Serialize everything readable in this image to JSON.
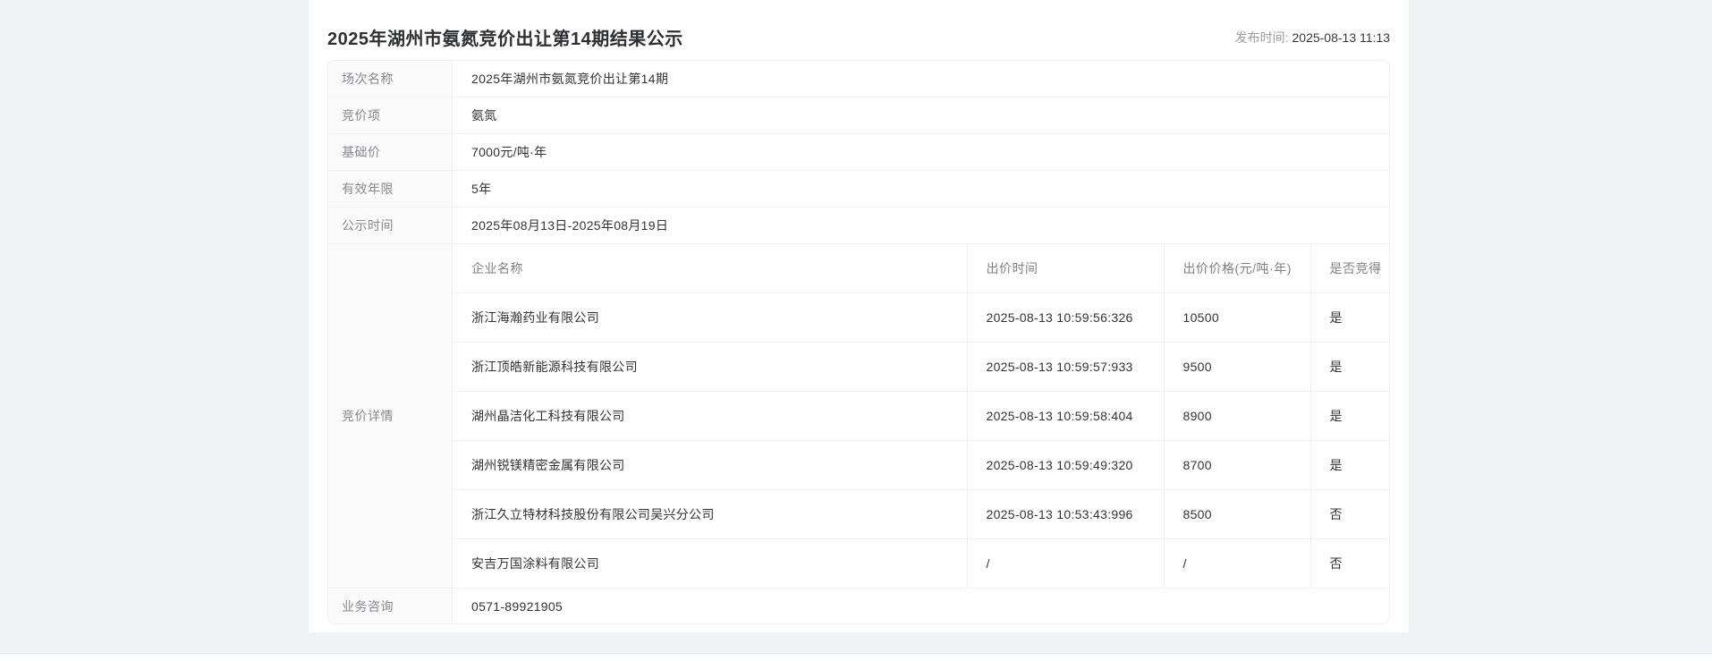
{
  "page": {
    "title": "2025年湖州市氨氮竞价出让第14期结果公示",
    "publish_time_label": "发布时间:",
    "publish_time": "2025-08-13 11:13"
  },
  "details": {
    "rows": [
      {
        "label": "场次名称",
        "value": "2025年湖州市氨氮竞价出让第14期"
      },
      {
        "label": "竞价项",
        "value": "氨氮"
      },
      {
        "label": "基础价",
        "value": "7000元/吨·年"
      },
      {
        "label": "有效年限",
        "value": "5年"
      },
      {
        "label": "公示时间",
        "value": "2025年08月13日-2025年08月19日"
      }
    ],
    "bid_details_label": "竞价详情",
    "contact_label": "业务咨询",
    "contact_value": "0571-89921905"
  },
  "bid_table": {
    "columns": [
      "企业名称",
      "出价时间",
      "出价价格(元/吨·年)",
      "是否竞得"
    ],
    "rows": [
      [
        "浙江海瀚药业有限公司",
        "2025-08-13 10:59:56:326",
        "10500",
        "是"
      ],
      [
        "浙江顶皓新能源科技有限公司",
        "2025-08-13 10:59:57:933",
        "9500",
        "是"
      ],
      [
        "湖州晶洁化工科技有限公司",
        "2025-08-13 10:59:58:404",
        "8900",
        "是"
      ],
      [
        "湖州锐镁精密金属有限公司",
        "2025-08-13 10:59:49:320",
        "8700",
        "是"
      ],
      [
        "浙江久立特材科技股份有限公司吴兴分公司",
        "2025-08-13 10:53:43:996",
        "8500",
        "否"
      ],
      [
        "安吉万国涂料有限公司",
        "/",
        "/",
        "否"
      ]
    ]
  },
  "colors": {
    "page_background": "#f0f2f5",
    "card_background": "#ffffff",
    "table_border": "#f0f0f0",
    "label_background": "#fafafa",
    "label_text": "#85888e",
    "value_text": "#333333"
  }
}
